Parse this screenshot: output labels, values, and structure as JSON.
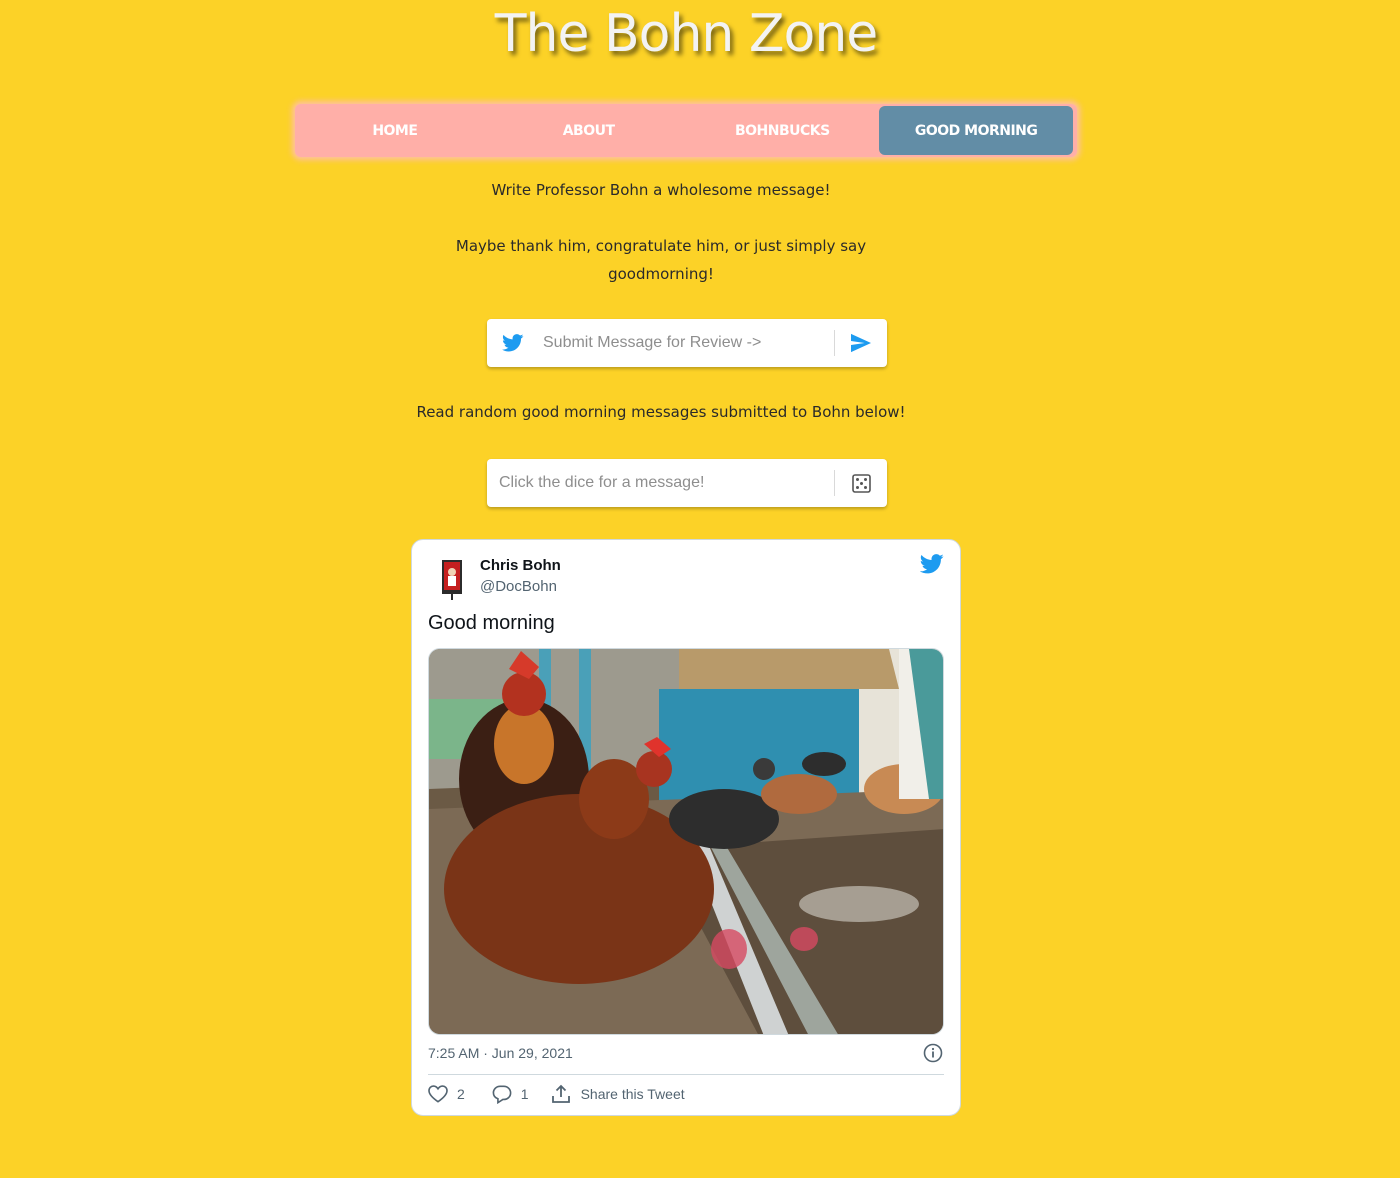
{
  "site": {
    "title": "The Bohn Zone"
  },
  "nav": {
    "items": [
      {
        "label": "HOME",
        "active": false
      },
      {
        "label": "ABOUT",
        "active": false
      },
      {
        "label": "BOHNBUCKS",
        "active": false
      },
      {
        "label": "GOOD MORNING",
        "active": true
      }
    ]
  },
  "intro": {
    "line1": "Write Professor Bohn a wholesome message!",
    "line2": "Maybe thank him, congratulate him, or just simply say goodmorning!"
  },
  "submit": {
    "placeholder": "Submit Message for Review ->",
    "value": "",
    "lead_icon": "twitter-bird-icon",
    "button_icon": "send-icon"
  },
  "read": {
    "text": "Read random good morning messages submitted to Bohn below!"
  },
  "dice": {
    "placeholder": "Click the dice for a message!",
    "value": "",
    "button_icon": "dice-icon"
  },
  "tweet": {
    "name": "Chris Bohn",
    "handle": "@DocBohn",
    "text": "Good morning",
    "timestamp": "7:25 AM · Jun 29, 2021",
    "likes": "2",
    "replies": "1",
    "share_label": "Share this Tweet",
    "media": "photo-of-chickens-in-coop"
  },
  "colors": {
    "background": "#fcd227",
    "nav_bg": "#ffafa8",
    "nav_active": "#628da6",
    "twitter_blue": "#1d9bf0"
  }
}
